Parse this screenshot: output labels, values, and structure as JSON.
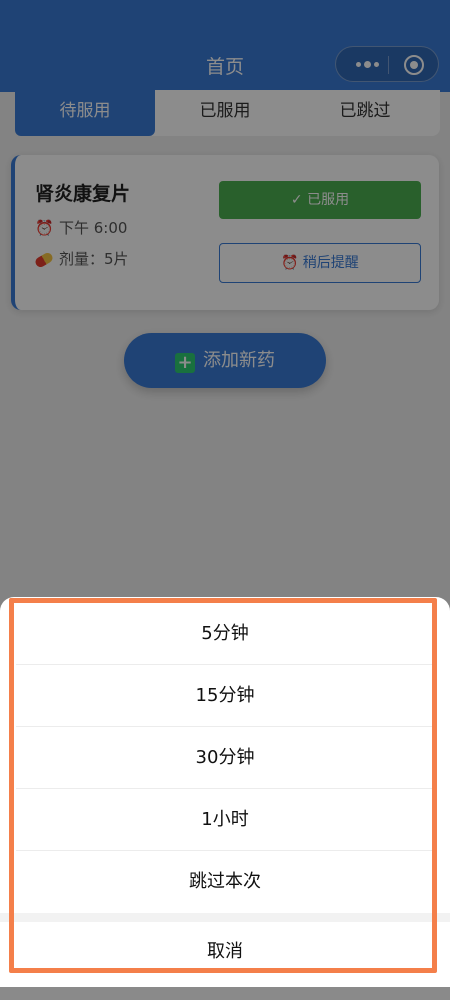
{
  "header": {
    "title": "首页"
  },
  "tabs": [
    {
      "label": "待服用"
    },
    {
      "label": "已服用"
    },
    {
      "label": "已跳过"
    }
  ],
  "medicine": {
    "name": "肾炎康复片",
    "time": "下午 6:00",
    "dose": "剂量：5片",
    "taken_label": "✓ 已服用",
    "later_label": "稍后提醒"
  },
  "add_button": {
    "label": "添加新药"
  },
  "action_sheet": {
    "options": [
      "5分钟",
      "15分钟",
      "30分钟",
      "1小时",
      "跳过本次"
    ],
    "cancel": "取消"
  },
  "colors": {
    "primary": "#3a7bd5",
    "success": "#4caf50",
    "highlight": "#f47f4a"
  }
}
